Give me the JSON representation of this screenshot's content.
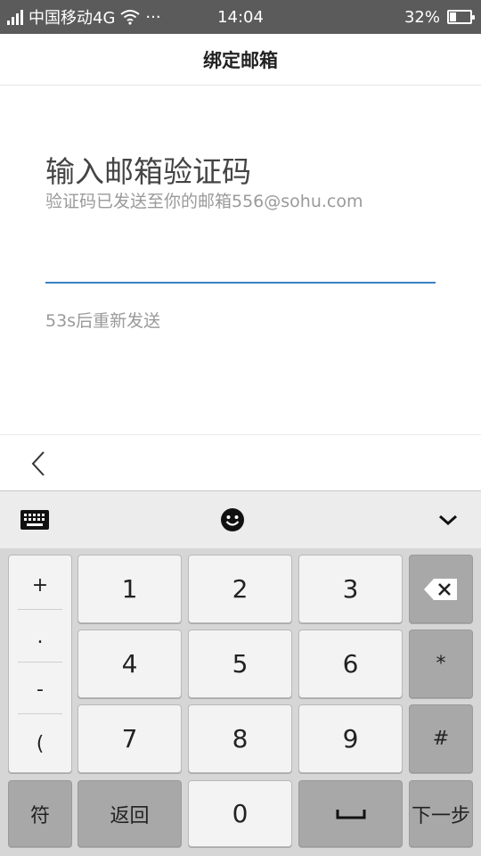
{
  "status_bar": {
    "carrier": "中国移动4G",
    "more": "···",
    "time": "14:04",
    "battery": "32%",
    "battery_level": 0.32
  },
  "header": {
    "title": "绑定邮箱"
  },
  "main": {
    "heading": "输入邮箱验证码",
    "subtext": "验证码已发送至你的邮箱556@sohu.com",
    "code_value": "",
    "resend_text": "53s后重新发送"
  },
  "keyboard": {
    "symbols": [
      "+",
      ".",
      "-",
      "("
    ],
    "digits": [
      "1",
      "2",
      "3",
      "4",
      "5",
      "6",
      "7",
      "8",
      "9",
      "0"
    ],
    "star": "*",
    "hash": "#",
    "sym_label": "符",
    "back_label": "返回",
    "next_label": "下一步"
  }
}
